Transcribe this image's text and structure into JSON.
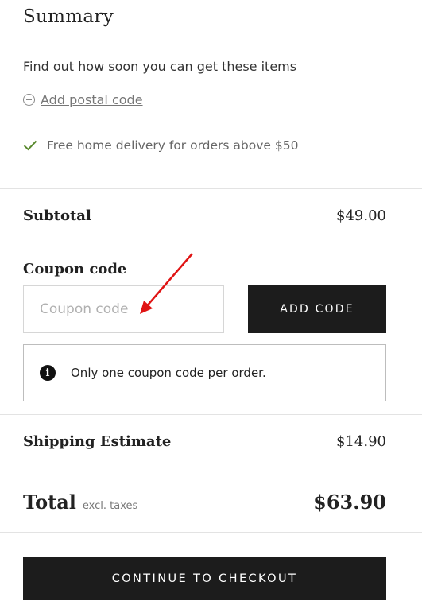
{
  "summary": {
    "title": "Summary",
    "find_out_text": "Find out how soon you can get these items",
    "add_postal_label": "Add postal code",
    "free_delivery_text": "Free home delivery for orders above $50"
  },
  "subtotal": {
    "label": "Subtotal",
    "value": "$49.00"
  },
  "coupon": {
    "heading": "Coupon code",
    "placeholder": "Coupon code",
    "value": "",
    "button_label": "ADD CODE",
    "notice": "Only one coupon code per order."
  },
  "shipping": {
    "label": "Shipping Estimate",
    "value": "$14.90"
  },
  "total": {
    "label": "Total",
    "note": "excl. taxes",
    "value": "$63.90"
  },
  "checkout": {
    "button_label": "CONTINUE TO CHECKOUT"
  },
  "colors": {
    "accent_dark": "#1c1c1c",
    "check_green": "#5a8a2f",
    "annotation_arrow": "#e01414"
  },
  "icons": {
    "add_postal": "plus-circle-icon",
    "delivery": "check-icon",
    "notice": "info-icon"
  }
}
